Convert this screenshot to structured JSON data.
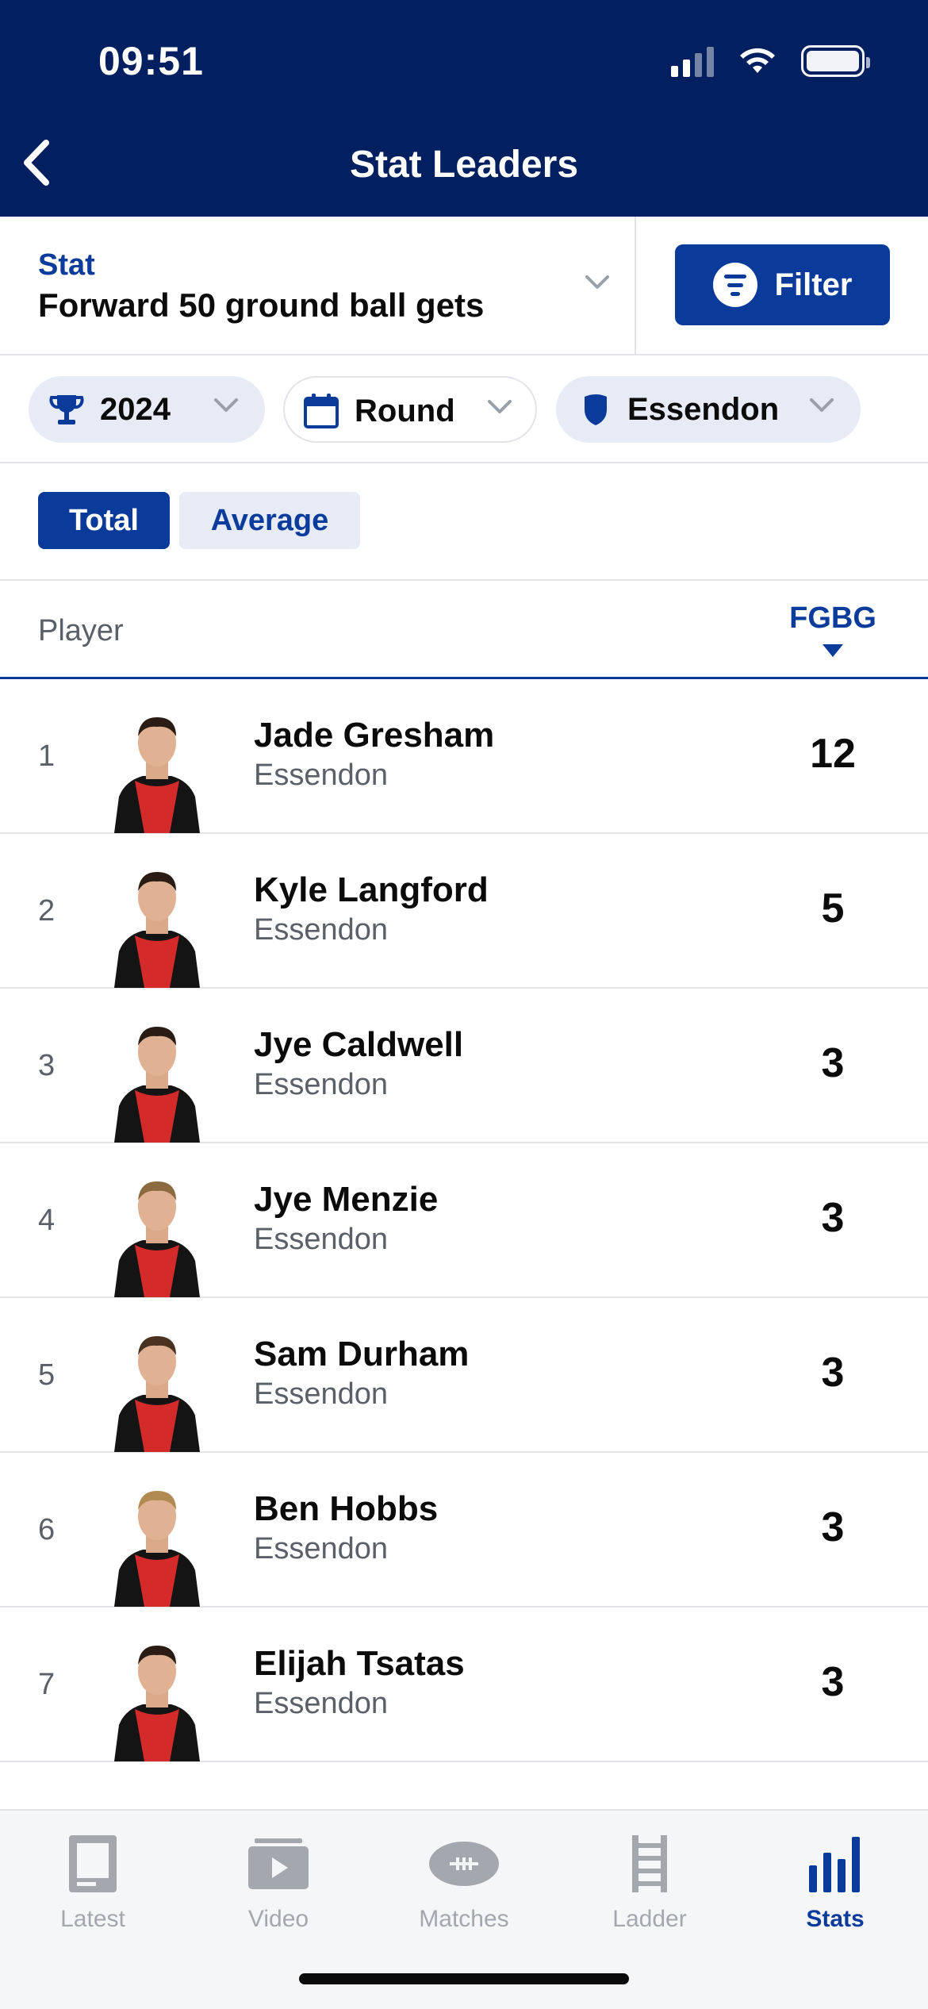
{
  "status_bar": {
    "time": "09:51"
  },
  "header": {
    "title": "Stat Leaders",
    "back_icon": "chevron-left-icon"
  },
  "stat_selector": {
    "label": "Stat",
    "value": "Forward 50 ground ball gets",
    "filter_label": "Filter"
  },
  "chips": [
    {
      "label": "2024",
      "icon": "trophy-icon"
    },
    {
      "label": "Round",
      "icon": "calendar-icon"
    },
    {
      "label": "Essendon",
      "icon": "shield-icon"
    }
  ],
  "toggle": {
    "total": "Total",
    "average": "Average",
    "selected": "Total"
  },
  "table": {
    "player_header": "Player",
    "stat_header": "FGBG",
    "rows": [
      {
        "rank": "1",
        "name": "Jade Gresham",
        "team": "Essendon",
        "value": "12"
      },
      {
        "rank": "2",
        "name": "Kyle Langford",
        "team": "Essendon",
        "value": "5"
      },
      {
        "rank": "3",
        "name": "Jye Caldwell",
        "team": "Essendon",
        "value": "3"
      },
      {
        "rank": "4",
        "name": "Jye Menzie",
        "team": "Essendon",
        "value": "3"
      },
      {
        "rank": "5",
        "name": "Sam Durham",
        "team": "Essendon",
        "value": "3"
      },
      {
        "rank": "6",
        "name": "Ben Hobbs",
        "team": "Essendon",
        "value": "3"
      },
      {
        "rank": "7",
        "name": "Elijah Tsatas",
        "team": "Essendon",
        "value": "3"
      }
    ]
  },
  "tab_bar": {
    "tabs": [
      {
        "label": "Latest",
        "icon": "newspaper-icon"
      },
      {
        "label": "Video",
        "icon": "video-icon"
      },
      {
        "label": "Matches",
        "icon": "football-icon"
      },
      {
        "label": "Ladder",
        "icon": "ladder-icon"
      },
      {
        "label": "Stats",
        "icon": "bar-chart-icon"
      }
    ],
    "active": "Stats"
  },
  "colors": {
    "navy": "#022060",
    "primary": "#0a3a9a",
    "chip_bg": "#e6ebf5",
    "jumper_red": "#d42a2a",
    "jumper_black": "#141414"
  }
}
